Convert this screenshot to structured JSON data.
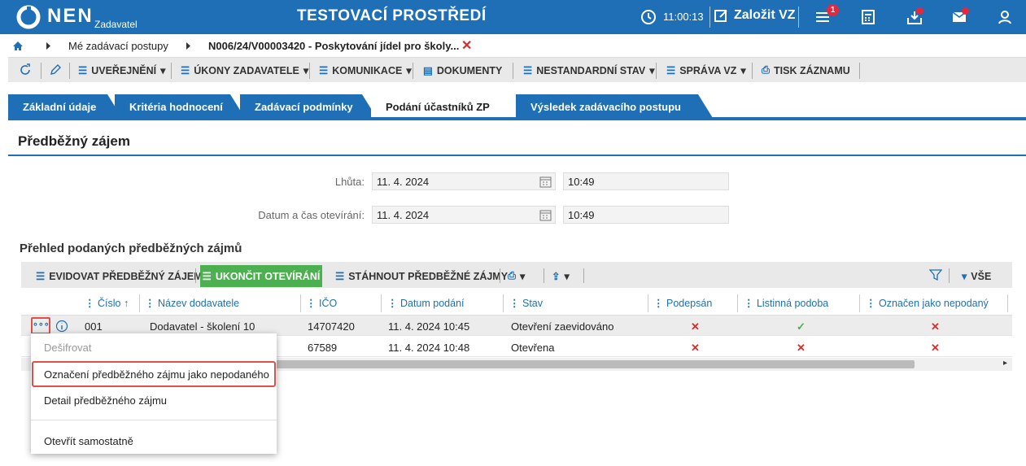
{
  "header": {
    "brand": "NEN",
    "brand_sub": "Zadavatel",
    "environment": "TESTOVACÍ PROSTŘEDÍ",
    "time": "11:00:13",
    "create_label": "Založit VZ",
    "notification_count": "1",
    "accent_color": "#1e6fb5"
  },
  "breadcrumb": {
    "items": [
      "Mé zadávací postupy",
      "N006/24/V00003420 - Poskytování jídel pro školy..."
    ]
  },
  "toolbar": {
    "items": [
      "UVEŘEJNĚNÍ",
      "ÚKONY ZADAVATELE",
      "KOMUNIKACE",
      "DOKUMENTY",
      "NESTANDARDNÍ STAV",
      "SPRÁVA VZ",
      "TISK ZÁZNAMU"
    ]
  },
  "tabs": [
    "Základní údaje",
    "Kritéria hodnocení",
    "Zadávací podmínky",
    "Podání účastníků ZP",
    "Výsledek zadávacího postupu"
  ],
  "section": {
    "title": "Předběžný zájem",
    "deadline_label": "Lhůta:",
    "deadline_date": "11. 4. 2024",
    "deadline_time": "10:49",
    "opening_label": "Datum a čas otevírání:",
    "opening_date": "11. 4. 2024",
    "opening_time": "10:49"
  },
  "grid": {
    "title": "Přehled podaných předběžných zájmů",
    "toolbar": {
      "record": "EVIDOVAT PŘEDBĚŽNÝ ZÁJEM",
      "finish": "UKONČIT OTEVÍRÁNÍ",
      "download": "STÁHNOUT PŘEDBĚŽNÉ ZÁJMY",
      "filter_all": "VŠE"
    },
    "columns": [
      "Číslo",
      "Název dodavatele",
      "IČO",
      "Datum podání",
      "Stav",
      "Podepsán",
      "Listinná podoba",
      "Označen jako nepodaný"
    ],
    "rows": [
      {
        "cislo": "001",
        "nazev": "Dodavatel - školení 10",
        "ico": "14707420",
        "datum": "11. 4. 2024 10:45",
        "stav": "Otevření zaevidováno",
        "podepsan": "✕",
        "listinna": "✓",
        "nepodany": "✕"
      },
      {
        "cislo": "",
        "nazev": "",
        "ico": "67589",
        "datum": "11. 4. 2024 10:48",
        "stav": "Otevřena",
        "podepsan": "✕",
        "listinna": "✕",
        "nepodany": "✕"
      }
    ]
  },
  "context_menu": {
    "items": [
      "Dešifrovat",
      "Označení předběžného zájmu jako nepodaného",
      "Detail předběžného zájmu",
      "Otevřít samostatně"
    ]
  }
}
